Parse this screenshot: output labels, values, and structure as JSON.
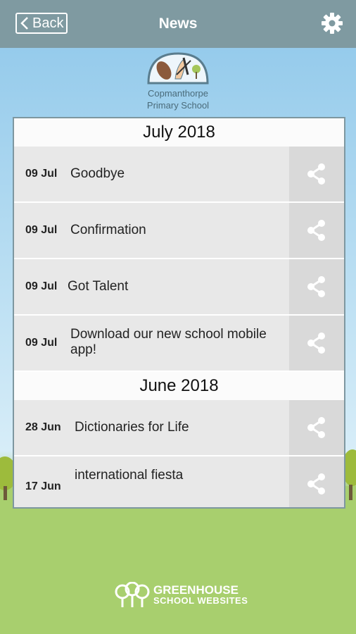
{
  "header": {
    "back_label": "Back",
    "title": "News"
  },
  "school": {
    "name_line1": "Copmanthorpe",
    "name_line2": "Primary School"
  },
  "sections": [
    {
      "month": "July 2018",
      "items": [
        {
          "date": "09 Jul",
          "title": "Goodbye"
        },
        {
          "date": "09 Jul",
          "title": "Confirmation"
        },
        {
          "date": "09 Jul",
          "title": "Got Talent"
        },
        {
          "date": "09 Jul",
          "title": "Download our new school mobile app!"
        }
      ]
    },
    {
      "month": "June 2018",
      "items": [
        {
          "date": "28 Jun",
          "title": "Dictionaries for Life"
        },
        {
          "date": "17 Jun",
          "title": "international fiesta"
        }
      ]
    }
  ],
  "footer": {
    "brand_line1": "GREENHOUSE",
    "brand_line2": "SCHOOL WEBSITES"
  },
  "colors": {
    "header_bg": "#7f9aa1",
    "grass": "#a8cf6e",
    "panel_border": "#7e97a0"
  },
  "icons": {
    "back": "chevron-left-icon",
    "settings": "gear-icon",
    "share": "share-icon"
  }
}
